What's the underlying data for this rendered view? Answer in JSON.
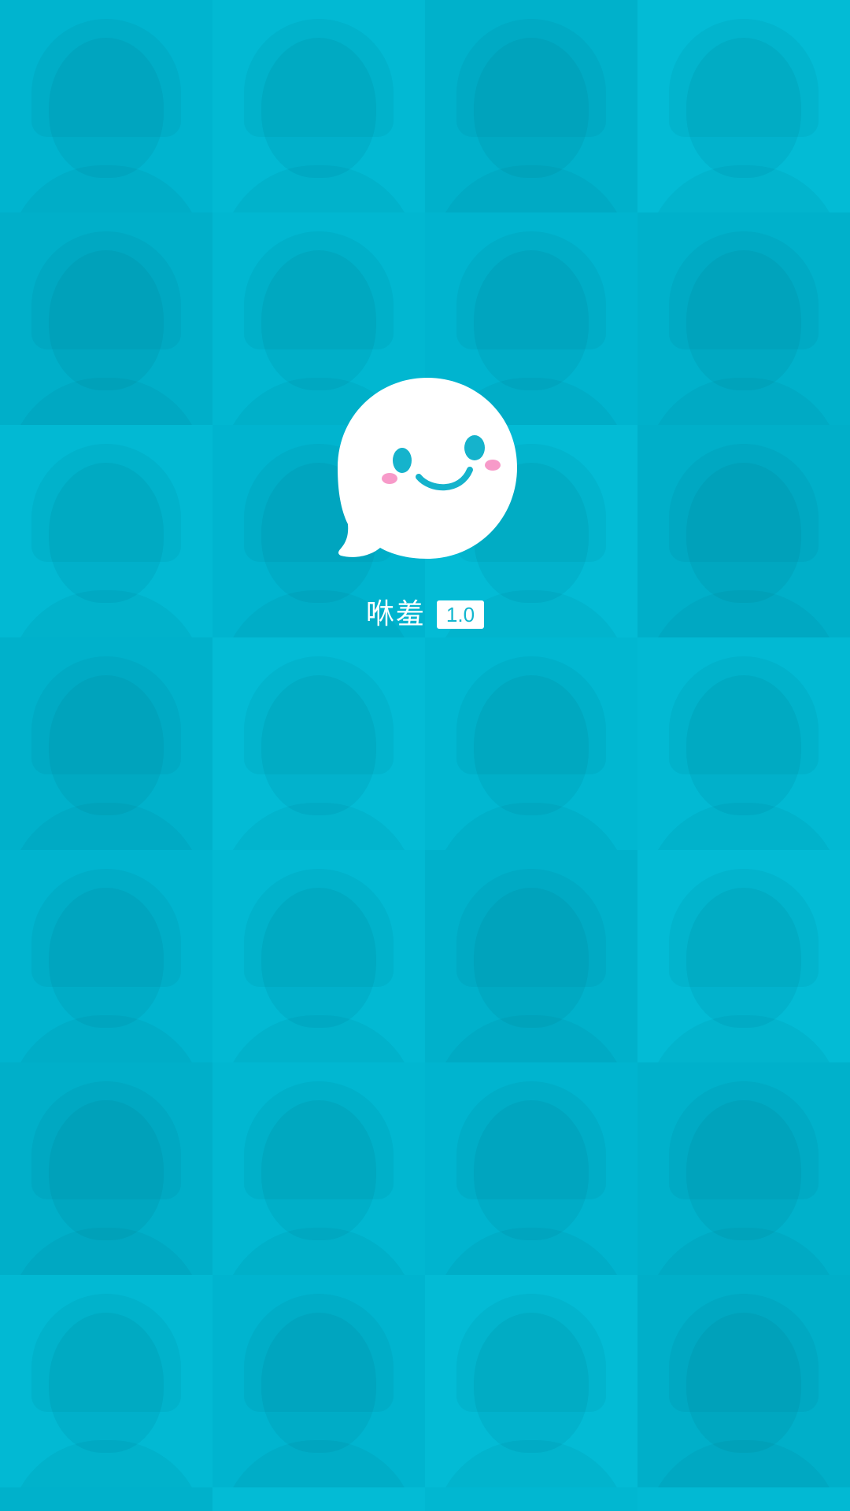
{
  "splash": {
    "app_name": "咻羞",
    "version": "1.0",
    "logo_icon": "smiling-speech-bubble-icon"
  },
  "colors": {
    "background": "#00b6d0",
    "logo_fill": "#ffffff",
    "logo_features": "#15b3cc",
    "blush": "#f79ac9",
    "badge_text": "#12b6cf"
  },
  "background": {
    "description_icon": "photo-mosaic-background"
  }
}
